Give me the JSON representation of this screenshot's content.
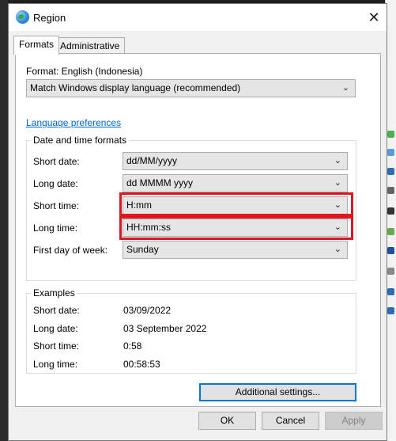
{
  "window": {
    "title": "Region",
    "close_glyph": "✕"
  },
  "tabs": [
    {
      "label": "Formats",
      "active": true
    },
    {
      "label": "Administrative",
      "active": false
    }
  ],
  "format": {
    "label": "Format: English (Indonesia)",
    "value": "Match Windows display language (recommended)"
  },
  "language_preferences_link": "Language preferences",
  "date_time_formats": {
    "title": "Date and time formats",
    "rows": [
      {
        "label": "Short date:",
        "value": "dd/MM/yyyy"
      },
      {
        "label": "Long date:",
        "value": "dd MMMM yyyy"
      },
      {
        "label": "Short time:",
        "value": "H:mm"
      },
      {
        "label": "Long time:",
        "value": "HH:mm:ss"
      },
      {
        "label": "First day of week:",
        "value": "Sunday"
      }
    ]
  },
  "examples": {
    "title": "Examples",
    "rows": [
      {
        "label": "Short date:",
        "value": "03/09/2022"
      },
      {
        "label": "Long date:",
        "value": "03 September 2022"
      },
      {
        "label": "Short time:",
        "value": "0:58"
      },
      {
        "label": "Long time:",
        "value": "00:58:53"
      }
    ]
  },
  "buttons": {
    "additional_settings": "Additional settings...",
    "ok": "OK",
    "cancel": "Cancel",
    "apply": "Apply"
  },
  "colors": {
    "highlight": "#e1141f",
    "link": "#0066cc",
    "focus": "#0078d7"
  }
}
